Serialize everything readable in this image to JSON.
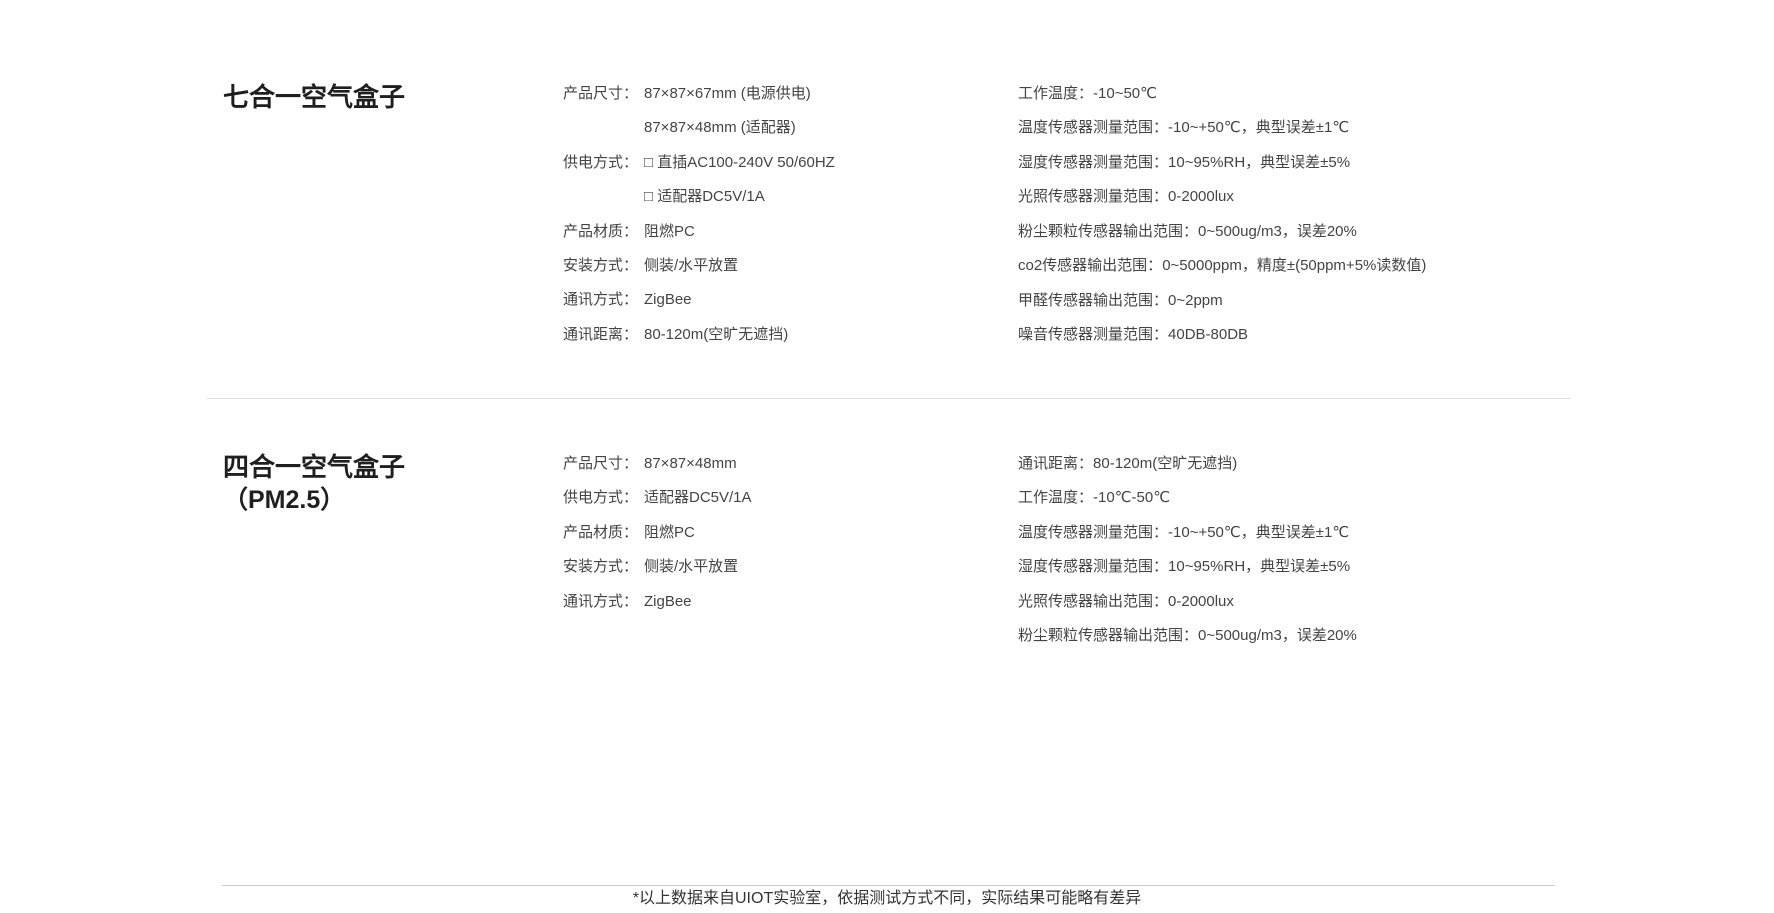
{
  "products": [
    {
      "title": "七合一空气盒子",
      "subtitle": "",
      "left_specs": [
        {
          "label": "产品尺寸：",
          "value": "87×87×67mm (电源供电)"
        },
        {
          "label": "",
          "value": "87×87×48mm (适配器)"
        },
        {
          "label": "供电方式：",
          "value": "□ 直插AC100-240V 50/60HZ"
        },
        {
          "label": "",
          "value": "□ 适配器DC5V/1A"
        },
        {
          "label": "产品材质：",
          "value": "阻燃PC"
        },
        {
          "label": "安装方式：",
          "value": "侧装/水平放置"
        },
        {
          "label": "通讯方式：",
          "value": "ZigBee"
        },
        {
          "label": "通讯距离：",
          "value": "80-120m(空旷无遮挡)"
        }
      ],
      "right_specs": [
        {
          "label": "工作温度：",
          "value": "-10~50℃"
        },
        {
          "label": "温度传感器测量范围：",
          "value": "-10~+50℃，典型误差±1℃"
        },
        {
          "label": "湿度传感器测量范围：",
          "value": "10~95%RH，典型误差±5%"
        },
        {
          "label": "光照传感器测量范围：",
          "value": "0-2000lux"
        },
        {
          "label": "粉尘颗粒传感器输出范围：",
          "value": "0~500ug/m3，误差20%"
        },
        {
          "label": "co2传感器输出范围：",
          "value": "0~5000ppm，精度±(50ppm+5%读数值)"
        },
        {
          "label": "甲醛传感器输出范围：",
          "value": "0~2ppm"
        },
        {
          "label": "噪音传感器测量范围：",
          "value": "40DB-80DB"
        }
      ]
    },
    {
      "title": "四合一空气盒子",
      "subtitle": "（PM2.5）",
      "left_specs": [
        {
          "label": "产品尺寸：",
          "value": "87×87×48mm"
        },
        {
          "label": "供电方式：",
          "value": "适配器DC5V/1A"
        },
        {
          "label": "产品材质：",
          "value": "阻燃PC"
        },
        {
          "label": "安装方式：",
          "value": "侧装/水平放置"
        },
        {
          "label": "通讯方式：",
          "value": "ZigBee"
        }
      ],
      "right_specs": [
        {
          "label": "通讯距离：",
          "value": "80-120m(空旷无遮挡)"
        },
        {
          "label": "工作温度：",
          "value": "-10℃-50℃"
        },
        {
          "label": "温度传感器测量范围：",
          "value": "-10~+50℃，典型误差±1℃"
        },
        {
          "label": "湿度传感器测量范围：",
          "value": "10~95%RH，典型误差±5%"
        },
        {
          "label": "光照传感器输出范围：",
          "value": "0-2000lux"
        },
        {
          "label": "粉尘颗粒传感器输出范围：",
          "value": "0~500ug/m3，误差20%"
        }
      ]
    }
  ],
  "footer": {
    "note": "*以上数据来自UIOT实验室，依据测试方式不同，实际结果可能略有差异"
  }
}
